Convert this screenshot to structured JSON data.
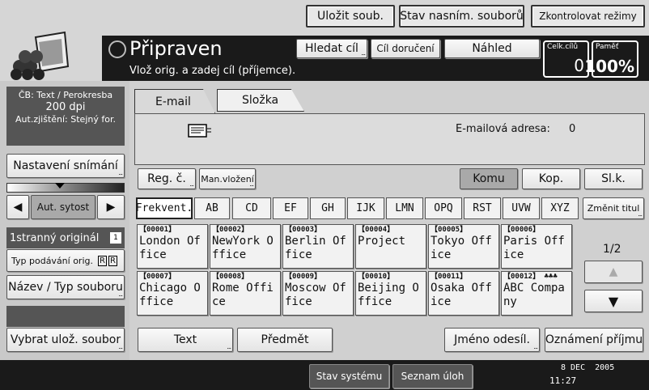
{
  "top_bar": {
    "save_file": "Uložit soub.",
    "scan_status": "Stav nasním. souborů",
    "check_modes": "Zkontrolovat režimy"
  },
  "status": {
    "title": "Připraven",
    "message": "Vlož orig. a zadej cíl (příjemce)."
  },
  "header_buttons": {
    "search_dest": "Hledat cíl",
    "delivery_dest": "Cíl doručení",
    "preview": "Náhled"
  },
  "counters": {
    "total_dest_label": "Celk.cílů",
    "total_dest_value": "0",
    "memory_label": "Paměť",
    "memory_value": "100%"
  },
  "settings": {
    "line1": "ČB: Text / Perokresba",
    "line2": "200 dpi",
    "line3": "Aut.zjištění: Stejný for.",
    "scan_settings": "Nastavení snímání",
    "density": "Aut. sytost",
    "original": "1stranný originál",
    "feed_type": "Typ podávání orig.",
    "file_name": "Název / Typ souboru",
    "select_file": "Vybrat ulož. soubor"
  },
  "tabs": [
    {
      "label": "E-mail"
    },
    {
      "label": "Složka"
    }
  ],
  "email": {
    "address_label": "E-mailová adresa:",
    "address_count": "0"
  },
  "row_buttons": {
    "reg_no": "Reg. č.",
    "manual": "Man.vložení",
    "to": "Komu",
    "cc": "Kop.",
    "bcc": "Sl.k."
  },
  "index_tabs": [
    "Frekvent.",
    "AB",
    "CD",
    "EF",
    "GH",
    "IJK",
    "LMN",
    "OPQ",
    "RST",
    "UVW",
    "XYZ"
  ],
  "change_title": "Změnit titul",
  "destinations": [
    {
      "num": "【00001】",
      "name": "London Office"
    },
    {
      "num": "【00002】",
      "name": "NewYork Office"
    },
    {
      "num": "【00003】",
      "name": "Berlin Office"
    },
    {
      "num": "【00004】",
      "name": "Project"
    },
    {
      "num": "【00005】",
      "name": "Tokyo Office"
    },
    {
      "num": "【00006】",
      "name": "Paris Office"
    },
    {
      "num": "【00007】",
      "name": "Chicago Office"
    },
    {
      "num": "【00008】",
      "name": "Rome Office"
    },
    {
      "num": "【00009】",
      "name": "Moscow Office"
    },
    {
      "num": "【00010】",
      "name": "Beijing Office"
    },
    {
      "num": "【00011】",
      "name": "Osaka Office"
    },
    {
      "num": "【00012】",
      "name": "ABC Company"
    }
  ],
  "page": "1/2",
  "bottom_buttons": {
    "text": "Text",
    "subject": "Předmět",
    "sender": "Jméno odesíl.",
    "receipt": "Oznámení příjmu"
  },
  "status_bar": {
    "system_status": "Stav systému",
    "job_list": "Seznam úloh",
    "date": "8 DEC  2005",
    "time": "11:27"
  }
}
